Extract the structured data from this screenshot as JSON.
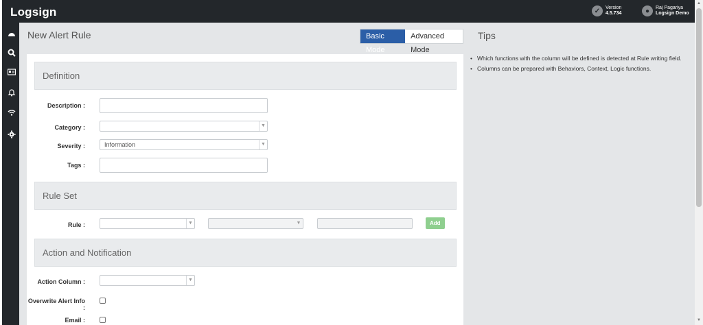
{
  "app": {
    "name": "Logsign"
  },
  "header": {
    "version_label": "Version",
    "version_value": "4.5.734",
    "user_name": "Raj Pagariya",
    "user_org": "Logsign Demo"
  },
  "sidebar": {
    "items": [
      {
        "icon": "dashboard-icon"
      },
      {
        "icon": "search-icon"
      },
      {
        "icon": "id-card-icon"
      },
      {
        "icon": "bell-icon"
      },
      {
        "icon": "wifi-icon"
      },
      {
        "icon": "gear-icon"
      }
    ]
  },
  "main": {
    "title": "New Alert Rule",
    "modes": [
      "Basic Mode",
      "Advanced Mode"
    ],
    "active_mode": "Basic Mode",
    "sections": {
      "definition": "Definition",
      "rule_set": "Rule Set",
      "action": "Action and Notification"
    },
    "fields": {
      "description": {
        "label": "Description :",
        "value": ""
      },
      "category": {
        "label": "Category :",
        "value": ""
      },
      "severity": {
        "label": "Severity :",
        "value": "Information"
      },
      "tags": {
        "label": "Tags :",
        "value": ""
      },
      "rule": {
        "label": "Rule :",
        "value": ""
      },
      "add_button": "Add",
      "action_column": {
        "label": "Action Column :",
        "value": ""
      },
      "overwrite": {
        "label": "Overwrite Alert Info :",
        "checked": false
      },
      "email": {
        "label": "Email :",
        "checked": false
      }
    }
  },
  "tips": {
    "title": "Tips",
    "items": [
      "Which functions with the column will be defined is detected at Rule writing field.",
      "Columns can be prepared with Behaviors, Context, Logic functions."
    ]
  }
}
